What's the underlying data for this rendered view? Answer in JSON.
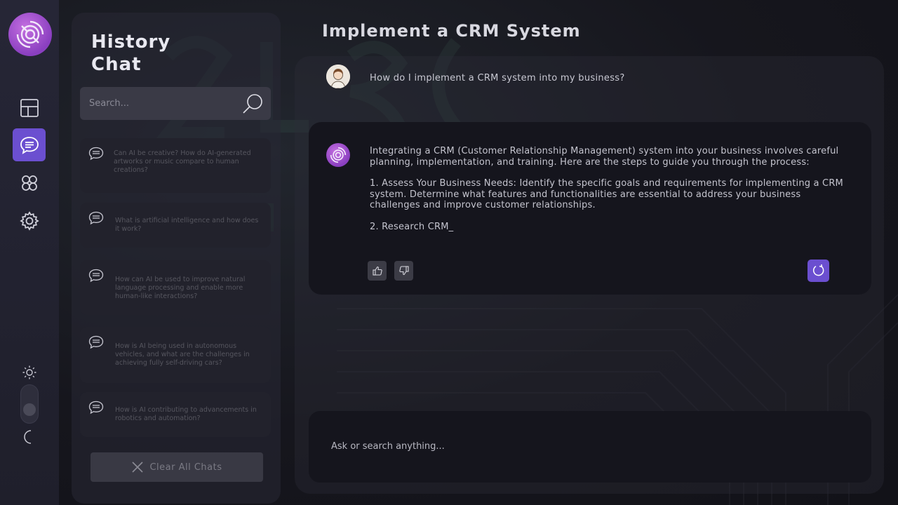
{
  "colors": {
    "accent": "#6b4fd0",
    "logo": "#9b4fcf",
    "rail_bg": "#242434",
    "panel_bg": "#15151d"
  },
  "rail": {
    "items": [
      {
        "icon": "layout-icon",
        "active": false
      },
      {
        "icon": "chat-icon",
        "active": true
      },
      {
        "icon": "community-icon",
        "active": false
      },
      {
        "icon": "gear-icon",
        "active": false
      }
    ],
    "theme": {
      "light_icon": "sun-icon",
      "dark_icon": "moon-icon"
    }
  },
  "history": {
    "title": "History Chat",
    "search_placeholder": "Search...",
    "items": [
      {
        "text": "Can AI be creative? How do AI-generated artworks or music compare to human creations?"
      },
      {
        "text": "What is artificial intelligence and how does it work?"
      },
      {
        "text": "How can AI be used to improve natural language processing and enable more human-like interactions?"
      },
      {
        "text": "How is AI being used in autonomous vehicles, and what are the challenges in achieving fully self-driving cars?"
      },
      {
        "text": "How is AI contributing to advancements in robotics and automation?"
      }
    ],
    "clear_label": "Clear All Chats"
  },
  "main": {
    "title": "Implement a CRM System",
    "user_message": "How do I implement a CRM system into my business?",
    "ai_paragraphs": [
      "Integrating a CRM (Customer Relationship Management) system into your business involves careful planning, implementation, and training. Here are the steps to guide you through the process:",
      "1. Assess Your Business Needs: Identify the specific goals and requirements for implementing a CRM system. Determine what features and functionalities are essential to address your business challenges and improve customer relationships.",
      "2. Research CRM_"
    ],
    "ask_placeholder": "Ask or search anything..."
  }
}
